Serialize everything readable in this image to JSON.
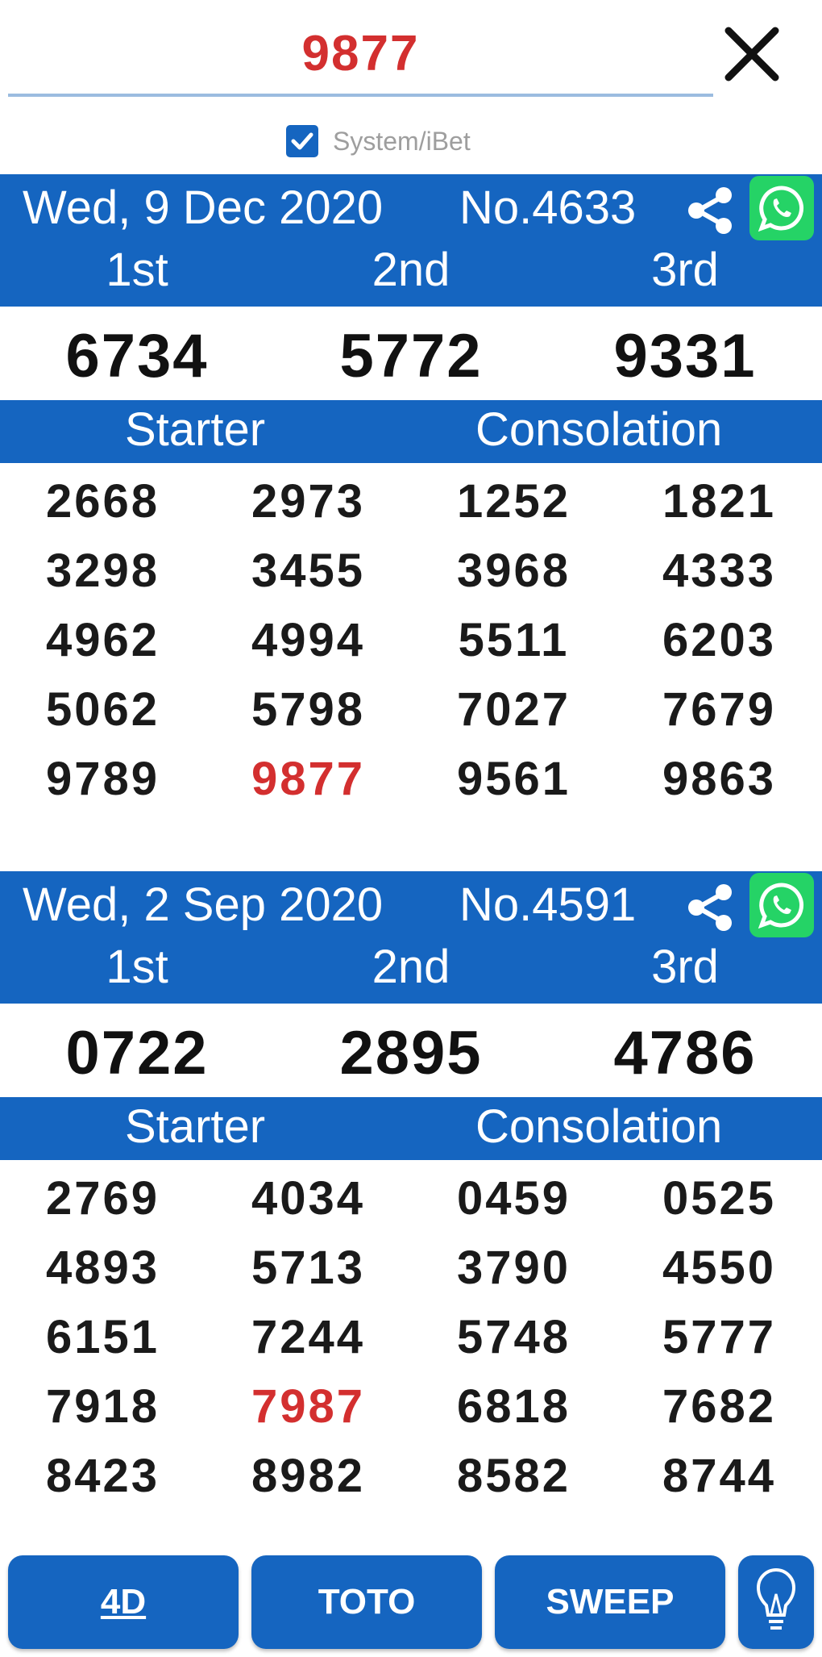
{
  "search": {
    "value": "9877",
    "placeholder": ""
  },
  "options": {
    "system_ibet_label": "System/iBet",
    "system_ibet_checked": true
  },
  "icons": {
    "close": "close-icon",
    "checkbox": "check-icon",
    "share": "share-icon",
    "whatsapp": "whatsapp-icon",
    "bulb": "lightbulb-icon"
  },
  "colors": {
    "primary": "#1565c0",
    "highlight": "#d32f2f",
    "whatsapp": "#25d366"
  },
  "draws": [
    {
      "date": "Wed, 9 Dec 2020",
      "draw_no": "No.4633",
      "prize_labels": [
        "1st",
        "2nd",
        "3rd"
      ],
      "prizes": [
        "6734",
        "5772",
        "9331"
      ],
      "section_labels": {
        "starter": "Starter",
        "consolation": "Consolation"
      },
      "grid": [
        [
          "2668",
          "2973",
          "1252",
          "1821"
        ],
        [
          "3298",
          "3455",
          "3968",
          "4333"
        ],
        [
          "4962",
          "4994",
          "5511",
          "6203"
        ],
        [
          "5062",
          "5798",
          "7027",
          "7679"
        ],
        [
          "9789",
          "9877",
          "9561",
          "9863"
        ]
      ],
      "highlighted": "9877"
    },
    {
      "date": "Wed, 2 Sep 2020",
      "draw_no": "No.4591",
      "prize_labels": [
        "1st",
        "2nd",
        "3rd"
      ],
      "prizes": [
        "0722",
        "2895",
        "4786"
      ],
      "section_labels": {
        "starter": "Starter",
        "consolation": "Consolation"
      },
      "grid": [
        [
          "2769",
          "4034",
          "0459",
          "0525"
        ],
        [
          "4893",
          "5713",
          "3790",
          "4550"
        ],
        [
          "6151",
          "7244",
          "5748",
          "5777"
        ],
        [
          "7918",
          "7987",
          "6818",
          "7682"
        ],
        [
          "8423",
          "8982",
          "8582",
          "8744"
        ]
      ],
      "highlighted": "7987"
    }
  ],
  "bottom_nav": {
    "tab_4d": "4D",
    "tab_toto": "TOTO",
    "tab_sweep": "SWEEP"
  }
}
